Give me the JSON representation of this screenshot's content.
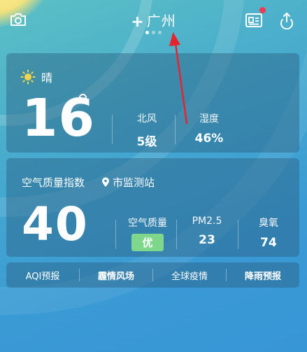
{
  "header": {
    "city": "广州",
    "plus": "+"
  },
  "weather": {
    "condition": "晴",
    "temperature": "16",
    "wind_label": "北风",
    "wind_value": "5级",
    "humidity_label": "湿度",
    "humidity_value": "46%"
  },
  "air": {
    "title": "空气质量指数",
    "station": "市监测站",
    "aqi": "40",
    "quality_label": "空气质量",
    "quality_value": "优",
    "pm25_label": "PM2.5",
    "pm25_value": "23",
    "ozone_label": "臭氧",
    "ozone_value": "74"
  },
  "links": [
    {
      "label": "AQI预报"
    },
    {
      "label": "霾情风场"
    },
    {
      "label": "全球疫情"
    },
    {
      "label": "降雨预报"
    }
  ],
  "colors": {
    "badge_good": "#7fd78c",
    "notification_dot": "#f2394d",
    "annotation_arrow": "#e8232e"
  },
  "icons": [
    "camera-icon",
    "news-icon",
    "share-icon",
    "sun-icon",
    "location-pin-icon"
  ]
}
